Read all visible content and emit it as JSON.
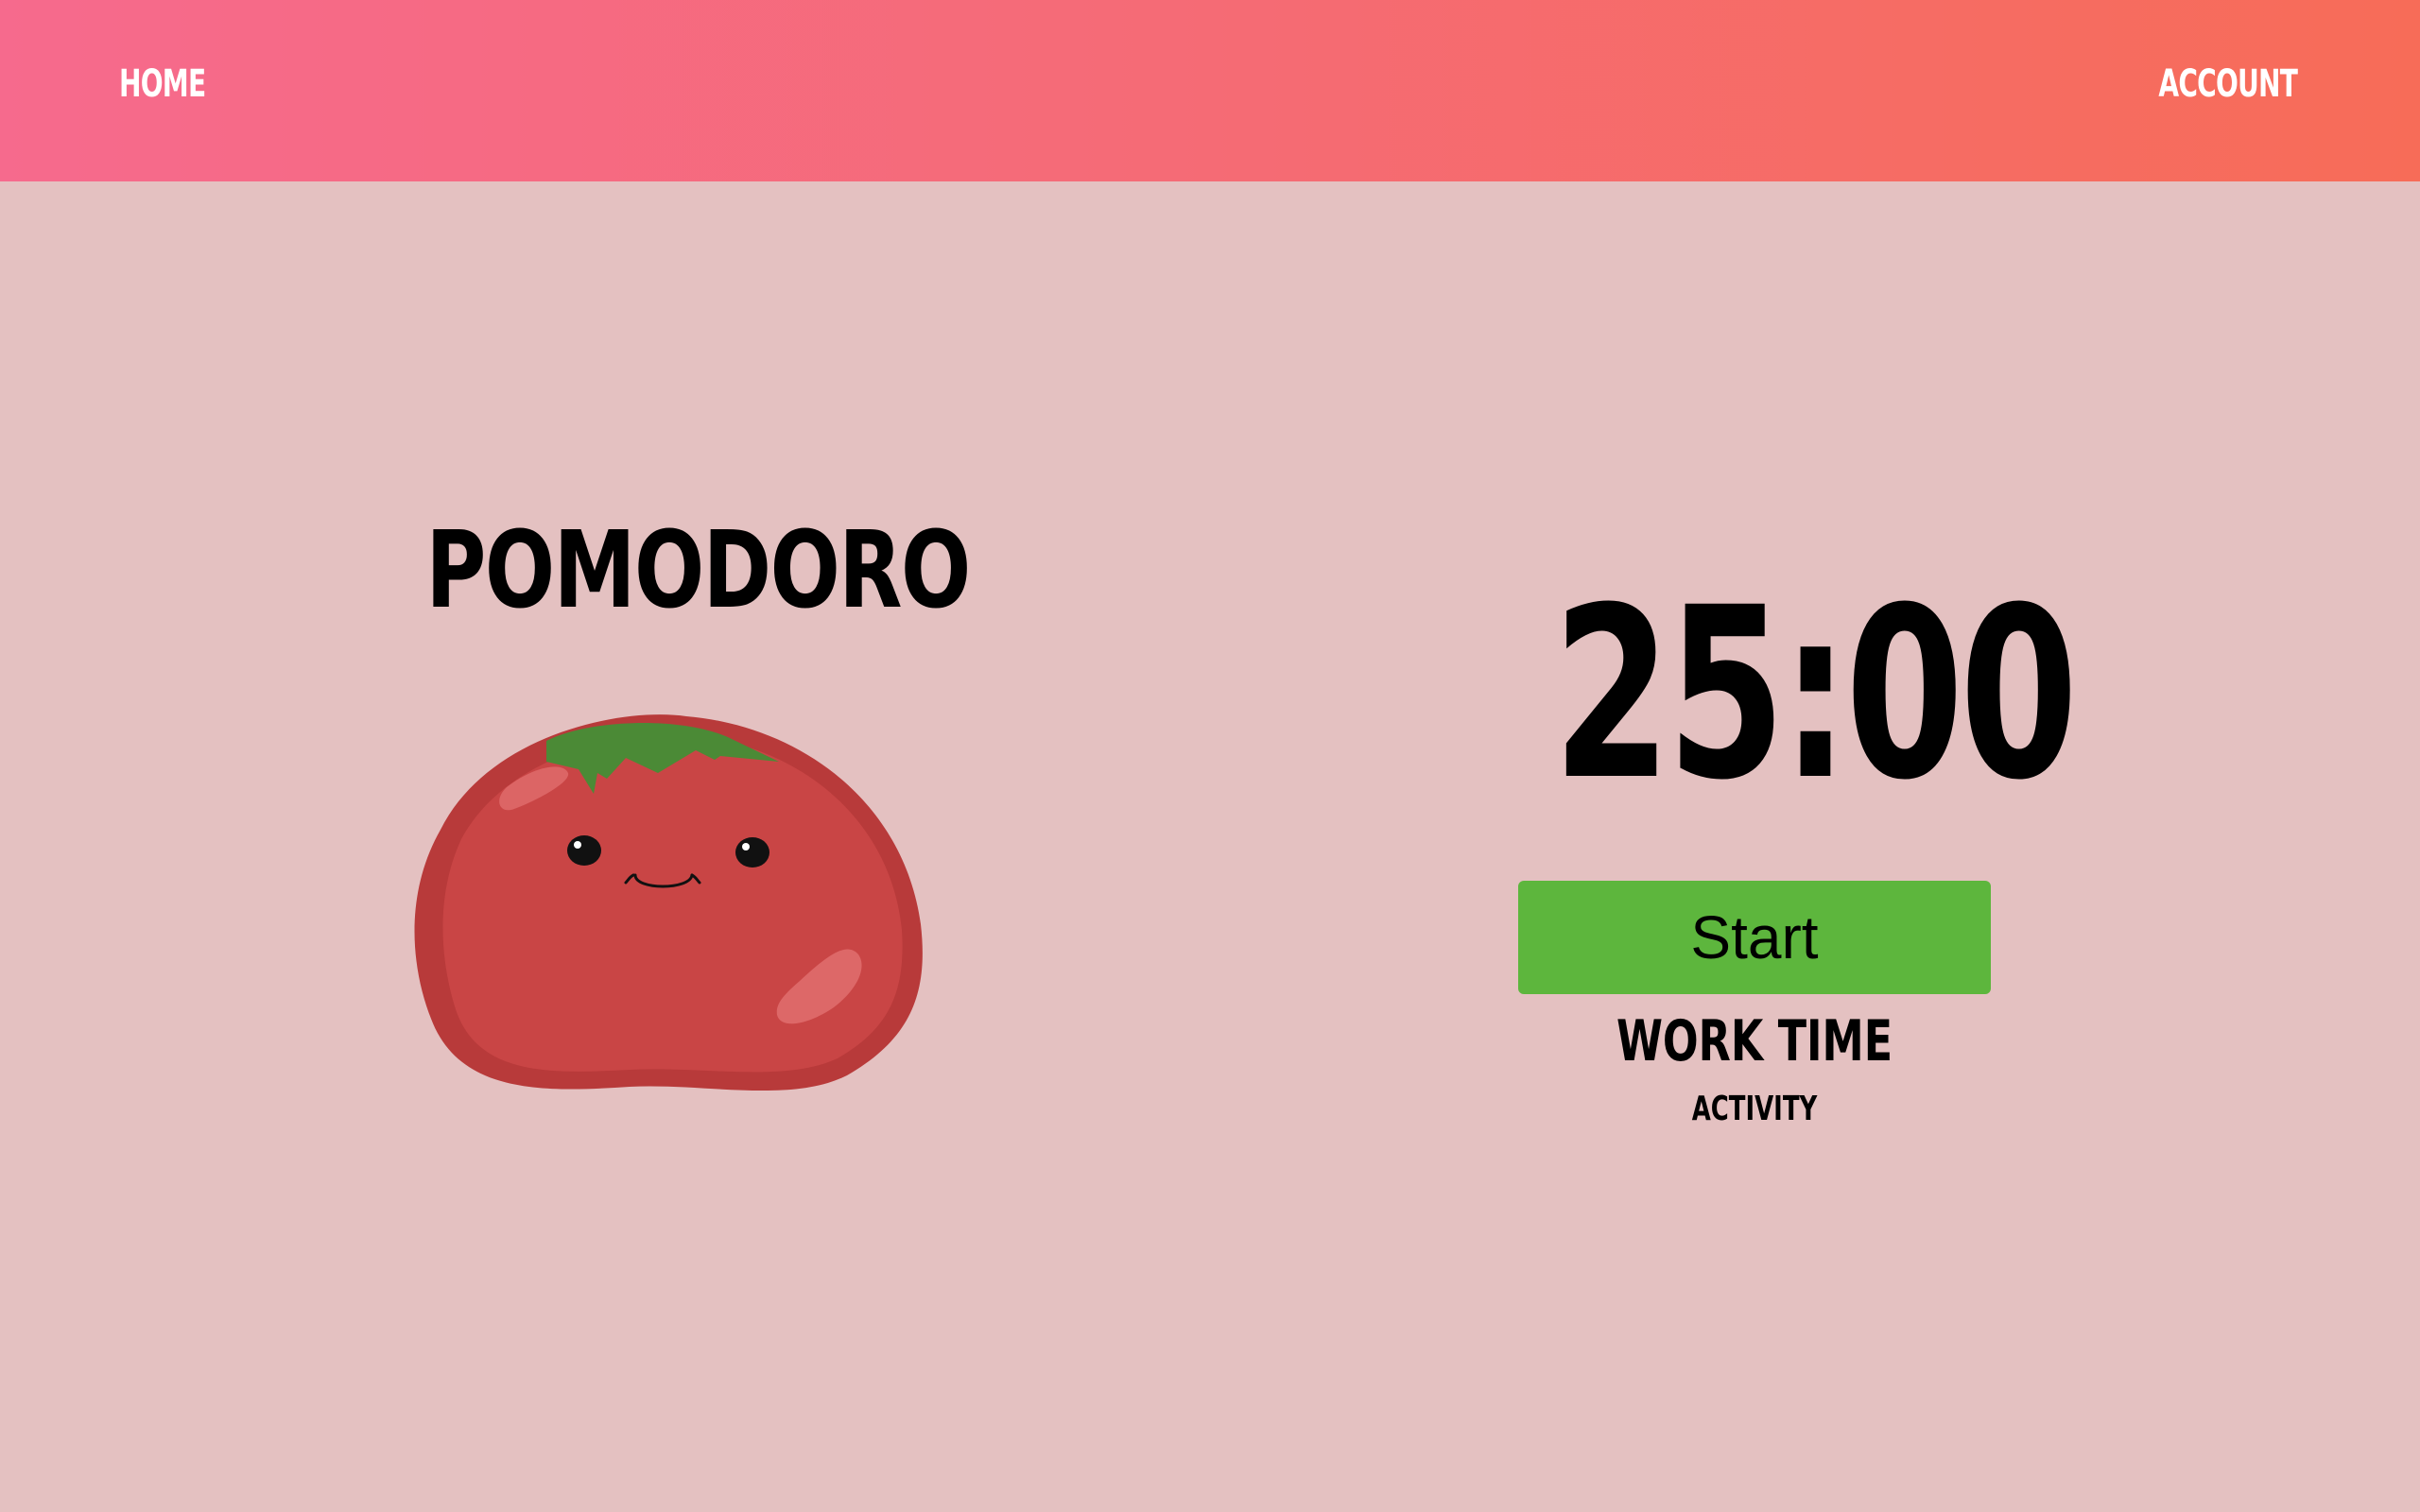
{
  "nav": {
    "home": "HOME",
    "account": "ACCOUNT"
  },
  "main": {
    "title": "POMODORO",
    "mascot_icon": "tomato-mascot",
    "timer": "25:00",
    "start_label": "Start",
    "mode": "WORK TIME",
    "activity": "ACTIVITY"
  },
  "colors": {
    "background": "#e4c1c1",
    "nav_gradient_start": "#f66a8d",
    "nav_gradient_end": "#f76c58",
    "start_button": "#5db63d",
    "tomato": "#c94545",
    "leaf": "#4b8a36"
  }
}
